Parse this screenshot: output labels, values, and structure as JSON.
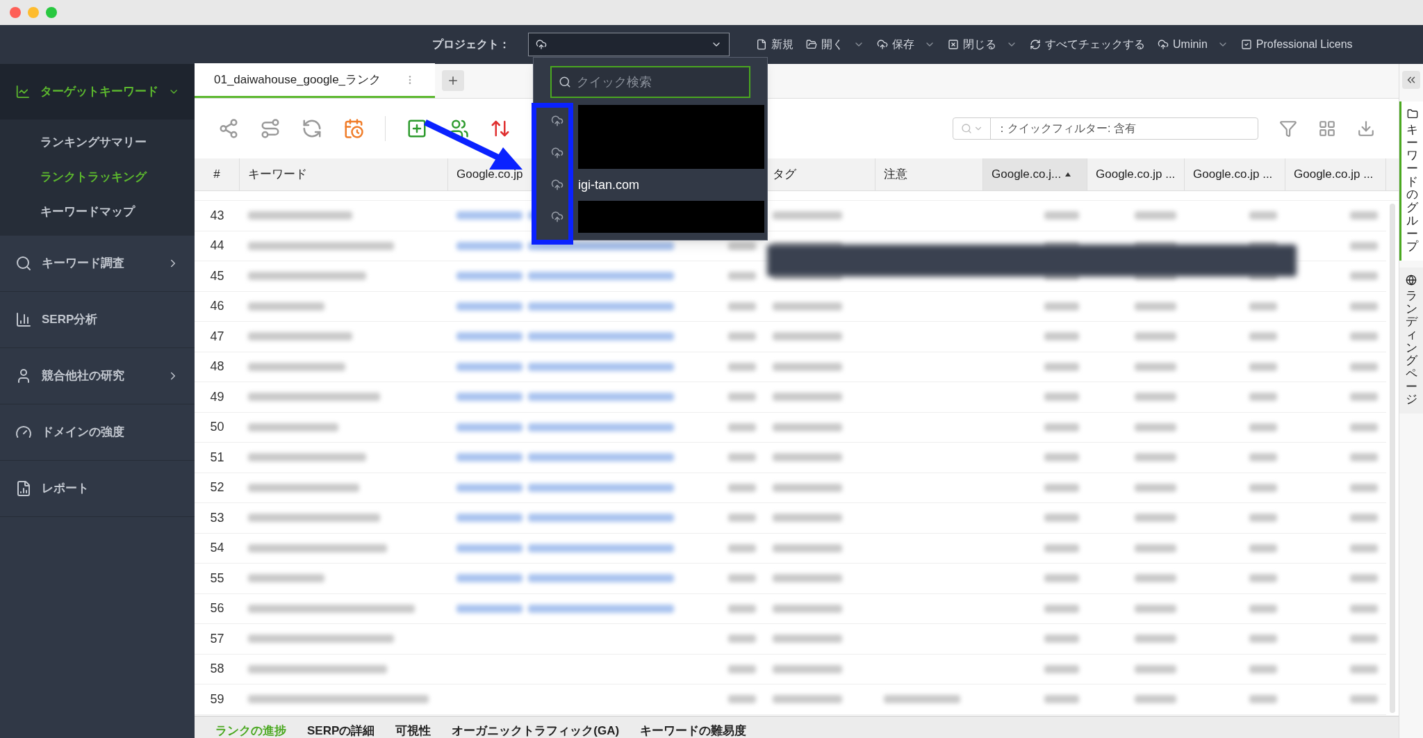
{
  "project_bar": {
    "label": "プロジェクト：",
    "actions": [
      {
        "label": "新規",
        "kind": "file",
        "menu": false
      },
      {
        "label": "開く",
        "kind": "folder",
        "menu": true
      },
      {
        "label": "保存",
        "kind": "cloud",
        "menu": true
      },
      {
        "label": "閉じる",
        "kind": "close",
        "menu": true
      },
      {
        "label": "すべてチェックする",
        "kind": "refresh",
        "menu": false
      },
      {
        "label": "Uminin",
        "kind": "cloud",
        "menu": true
      },
      {
        "label": "Professional Licens",
        "kind": "check",
        "menu": false
      }
    ]
  },
  "sidebar": {
    "items": [
      {
        "label": "ターゲットキーワード",
        "kind": "chart",
        "selected": true,
        "expanded": true,
        "children": [
          {
            "label": "ランキングサマリー",
            "selected": false
          },
          {
            "label": "ランクトラッキング",
            "selected": true
          },
          {
            "label": "キーワードマップ",
            "selected": false
          }
        ]
      },
      {
        "label": "キーワード調査",
        "kind": "search",
        "selected": false,
        "expanded": false
      },
      {
        "label": "SERP分析",
        "kind": "bars",
        "selected": false
      },
      {
        "label": "競合他社の研究",
        "kind": "person",
        "selected": false,
        "expanded": false
      },
      {
        "label": "ドメインの強度",
        "kind": "gauge",
        "selected": false
      },
      {
        "label": "レポート",
        "kind": "report",
        "selected": false
      }
    ]
  },
  "tabs": [
    {
      "label": "01_daiwahouse_google_ランク",
      "selected": true
    }
  ],
  "filter": {
    "placeholder": "：クイックフィルター: 含有"
  },
  "table": {
    "columns": [
      {
        "label": "#",
        "sorted": false
      },
      {
        "label": "キーワード",
        "sorted": false
      },
      {
        "label": "Google.co.jp",
        "sorted": false
      },
      {
        "label": "タグ",
        "sorted": false
      },
      {
        "label": "注意",
        "sorted": false
      },
      {
        "label": "Google.co.j...",
        "sorted": true
      },
      {
        "label": "Google.co.jp ...",
        "sorted": false
      },
      {
        "label": "Google.co.jp ...",
        "sorted": false
      },
      {
        "label": "Google.co.jp ...",
        "sorted": false
      }
    ],
    "rows": [
      {
        "number": "43",
        "has_url": true
      },
      {
        "number": "44",
        "has_url": true
      },
      {
        "number": "45",
        "has_url": true
      },
      {
        "number": "46",
        "has_url": true
      },
      {
        "number": "47",
        "has_url": true
      },
      {
        "number": "48",
        "has_url": true
      },
      {
        "number": "49",
        "has_url": true
      },
      {
        "number": "50",
        "has_url": true
      },
      {
        "number": "51",
        "has_url": true
      },
      {
        "number": "52",
        "has_url": true
      },
      {
        "number": "53",
        "has_url": true
      },
      {
        "number": "54",
        "has_url": true
      },
      {
        "number": "55",
        "has_url": true
      },
      {
        "number": "56",
        "has_url": true
      },
      {
        "number": "57",
        "has_url": false
      },
      {
        "number": "58",
        "has_url": false
      },
      {
        "number": "59",
        "has_url": false
      }
    ]
  },
  "project_menu": {
    "search_placeholder": "クイック検索",
    "items": [
      {
        "redacted": true
      },
      {
        "redacted": true
      },
      {
        "label": "igi-tan.com",
        "redacted": false
      },
      {
        "redacted": true
      }
    ]
  },
  "right_panel": {
    "tabs": [
      {
        "label": "キーワードのグループ",
        "kind": "folder",
        "selected": true
      },
      {
        "label": "ランディングページ",
        "kind": "globe",
        "selected": false
      }
    ]
  },
  "bottom_tabs": [
    {
      "label": "ランクの進捗",
      "selected": true
    },
    {
      "label": "SERPの詳細",
      "selected": false
    },
    {
      "label": "可視性",
      "selected": false
    },
    {
      "label": "オーガニックトラフィック(GA)",
      "selected": false
    },
    {
      "label": "キーワードの難易度",
      "selected": false
    }
  ]
}
